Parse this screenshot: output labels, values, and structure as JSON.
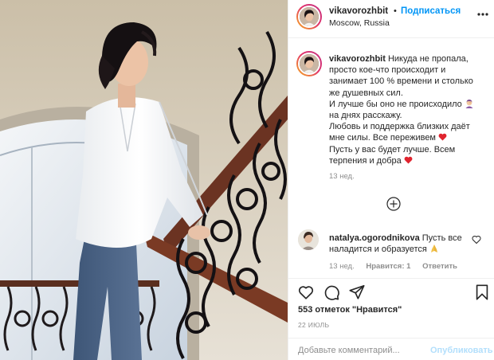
{
  "post": {
    "author": {
      "username": "vikavorozhbit",
      "location": "Moscow, Russia",
      "separator": "•",
      "follow_label": "Подписаться"
    },
    "caption": {
      "username": "vikavorozhbit",
      "lines": [
        " Никуда не пропала,",
        "просто кое-что происходит и",
        "занимает 100 % времени и столько",
        "же душевных сил.",
        "И лучше бы оно не происходило",
        "на днях расскажу.",
        "Любовь и поддержка близких даёт",
        "мне силы. Все переживем",
        "Пусть у вас будет лучше. Всем",
        "терпения и добра"
      ],
      "time": "13 нед."
    },
    "comments": [
      {
        "username": "natalya.ogorodnikova",
        "text_line1": " Пусть все",
        "text_line2": "наладится и образуется",
        "time": "13 нед.",
        "likes": "Нравится: 1",
        "reply_label": "Ответить"
      }
    ],
    "likes_text": "553 отметок \"Нравится\"",
    "date": "22 ИЮЛЬ",
    "add_comment": {
      "placeholder": "Добавьте комментарий...",
      "post_label": "Опубликовать"
    },
    "colors": {
      "link_blue": "#0095f6",
      "post_disabled": "#b2dffc",
      "heart_red": "#ed4956",
      "muted": "#8e8e8e"
    }
  }
}
